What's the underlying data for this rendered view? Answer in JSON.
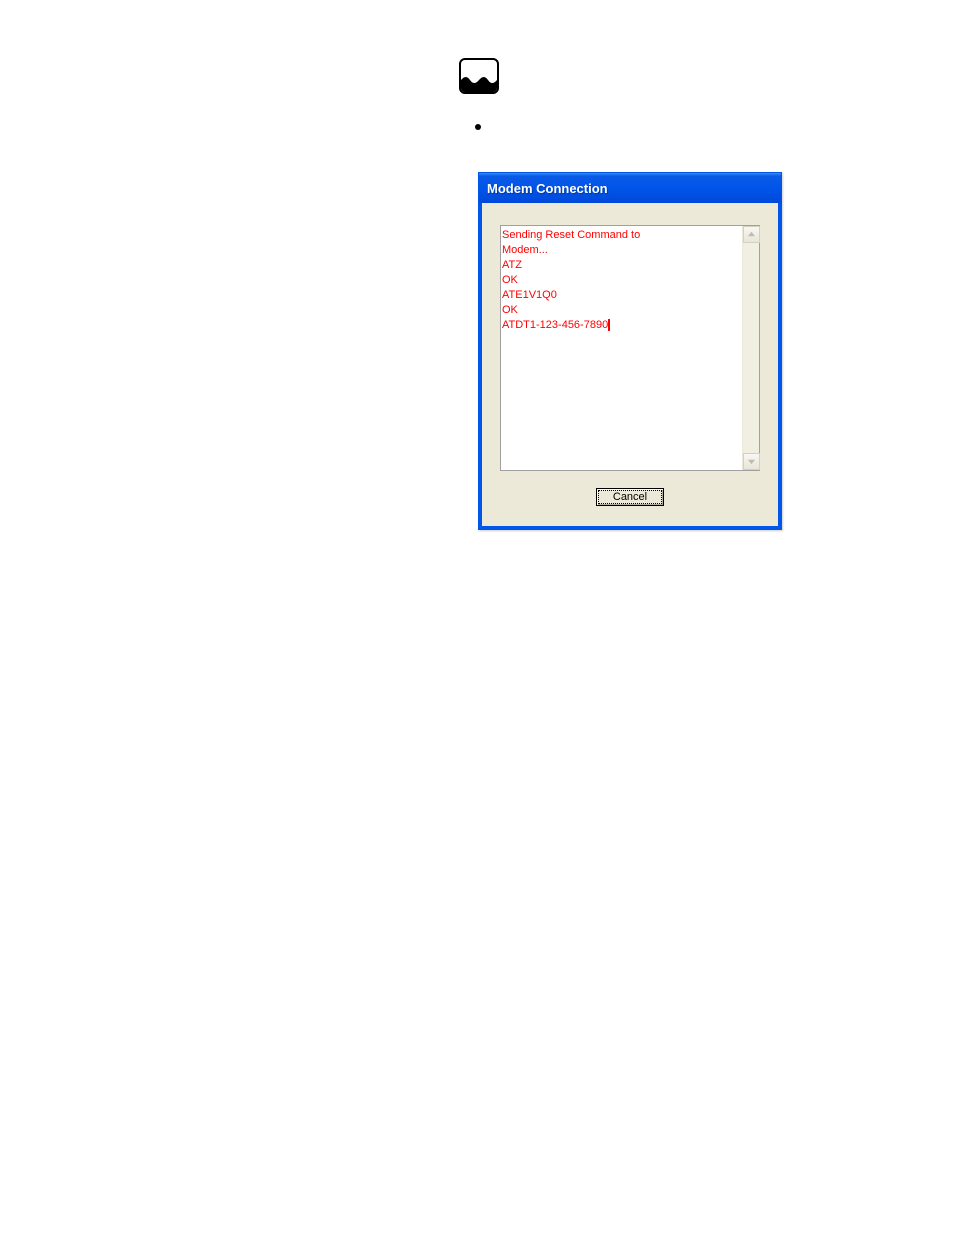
{
  "dialog": {
    "title": "Modem Connection",
    "log_lines": [
      "Sending Reset Command to",
      "Modem...",
      "ATZ",
      "OK",
      "ATE1V1Q0",
      "OK",
      "ATDT1-123-456-7890"
    ],
    "cancel_label": "Cancel"
  },
  "icons": {
    "logo": "wave-logo",
    "scroll_up": "chevron-up-icon",
    "scroll_down": "chevron-down-icon"
  }
}
